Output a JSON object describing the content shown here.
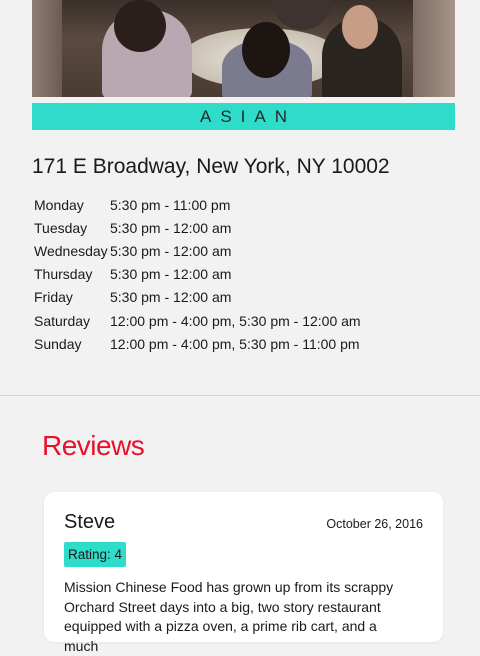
{
  "restaurant": {
    "cuisine": "ASIAN",
    "address": "171 E Broadway, New York, NY 10002",
    "hours": [
      {
        "day": "Monday",
        "time": "5:30 pm - 11:00 pm"
      },
      {
        "day": "Tuesday",
        "time": "5:30 pm - 12:00 am"
      },
      {
        "day": "Wednesday",
        "time": "5:30 pm - 12:00 am"
      },
      {
        "day": "Thursday",
        "time": "5:30 pm - 12:00 am"
      },
      {
        "day": "Friday",
        "time": "5:30 pm - 12:00 am"
      },
      {
        "day": "Saturday",
        "time": "12:00 pm - 4:00 pm, 5:30 pm - 12:00 am"
      },
      {
        "day": "Sunday",
        "time": "12:00 pm - 4:00 pm, 5:30 pm - 11:00 pm"
      }
    ]
  },
  "reviews": {
    "heading": "Reviews",
    "items": [
      {
        "name": "Steve",
        "date": "October 26, 2016",
        "rating_label": "Rating: 4",
        "rating": 4,
        "text": "Mission Chinese Food has grown up from its scrappy Orchard Street days into a big, two story restaurant equipped with a pizza oven, a prime rib cart, and a much"
      }
    ]
  },
  "colors": {
    "accent_teal": "#2fdcc9",
    "heading_red": "#e8112d",
    "background": "#f2f2f2"
  }
}
